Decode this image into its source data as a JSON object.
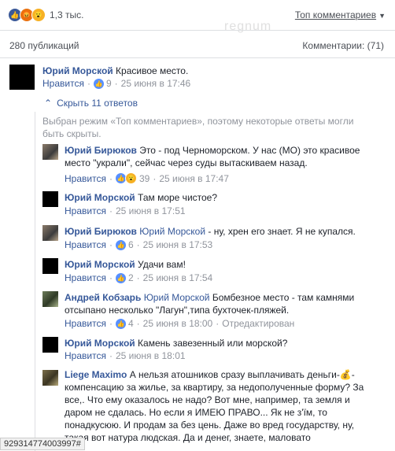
{
  "reactions": {
    "count": "1,3 тыс."
  },
  "sort_label": "Топ комментариев",
  "watermark": "regnum",
  "publications": "280 публикаций",
  "comments_count": "Комментарии: (71)",
  "main_comment": {
    "author": "Юрий Морской",
    "text": "Красивое место.",
    "like": "Нравится",
    "likes": "9",
    "time": "25 июня в 17:46"
  },
  "hide_replies": "Скрыть 11 ответов",
  "notice": "Выбран режим «Топ комментариев», поэтому некоторые ответы могли быть скрыты.",
  "replies": [
    {
      "author": "Юрий Бирюков",
      "mention": "",
      "text": "Это - под Черноморском. У нас (МО) это красивое место \"украли\", сейчас через суды вытаскиваем назад.",
      "like": "Нравится",
      "likes": "39",
      "time": "25 июня в 17:47",
      "edited": ""
    },
    {
      "author": "Юрий Морской",
      "mention": "",
      "text": "Там море чистое?",
      "like": "Нравится",
      "likes": "",
      "time": "25 июня в 17:51",
      "edited": ""
    },
    {
      "author": "Юрий Бирюков",
      "mention": "Юрий Морской",
      "text": "- ну, хрен его знает. Я не купался.",
      "like": "Нравится",
      "likes": "6",
      "time": "25 июня в 17:53",
      "edited": ""
    },
    {
      "author": "Юрий Морской",
      "mention": "",
      "text": "Удачи вам!",
      "like": "Нравится",
      "likes": "2",
      "time": "25 июня в 17:54",
      "edited": ""
    },
    {
      "author": "Андрей Кобзарь",
      "mention": "Юрий Морской",
      "text": "Бомбезное место - там камнями отсыпано несколько \"Лагун\",типа бухточек-пляжей.",
      "like": "Нравится",
      "likes": "4",
      "time": "25 июня в 18:00",
      "edited": "Отредактирован"
    },
    {
      "author": "Юрий Морской",
      "mention": "",
      "text": "Камень завезенный или морской?",
      "like": "Нравится",
      "likes": "",
      "time": "25 июня в 18:01",
      "edited": ""
    },
    {
      "author": "Liege Maximo",
      "mention": "",
      "text": "А нельзя атошников сразу выплачивать деньги-💰- компенсацию за жилье, за квартиру, за недополученные форму? За все,. Что ему оказалось не надо? Вот мне, например, та земля и даром не сдалась. Но если я ИМЕЮ ПРАВО... Як не з'їм, то понадкусюю. И продам за без цень. Даже во вред государству, ну, такая вот натура людская. Да и денег, знаете, маловато",
      "like": "",
      "likes": "",
      "time": "",
      "edited": ""
    }
  ],
  "status_id": "929314774003997#"
}
